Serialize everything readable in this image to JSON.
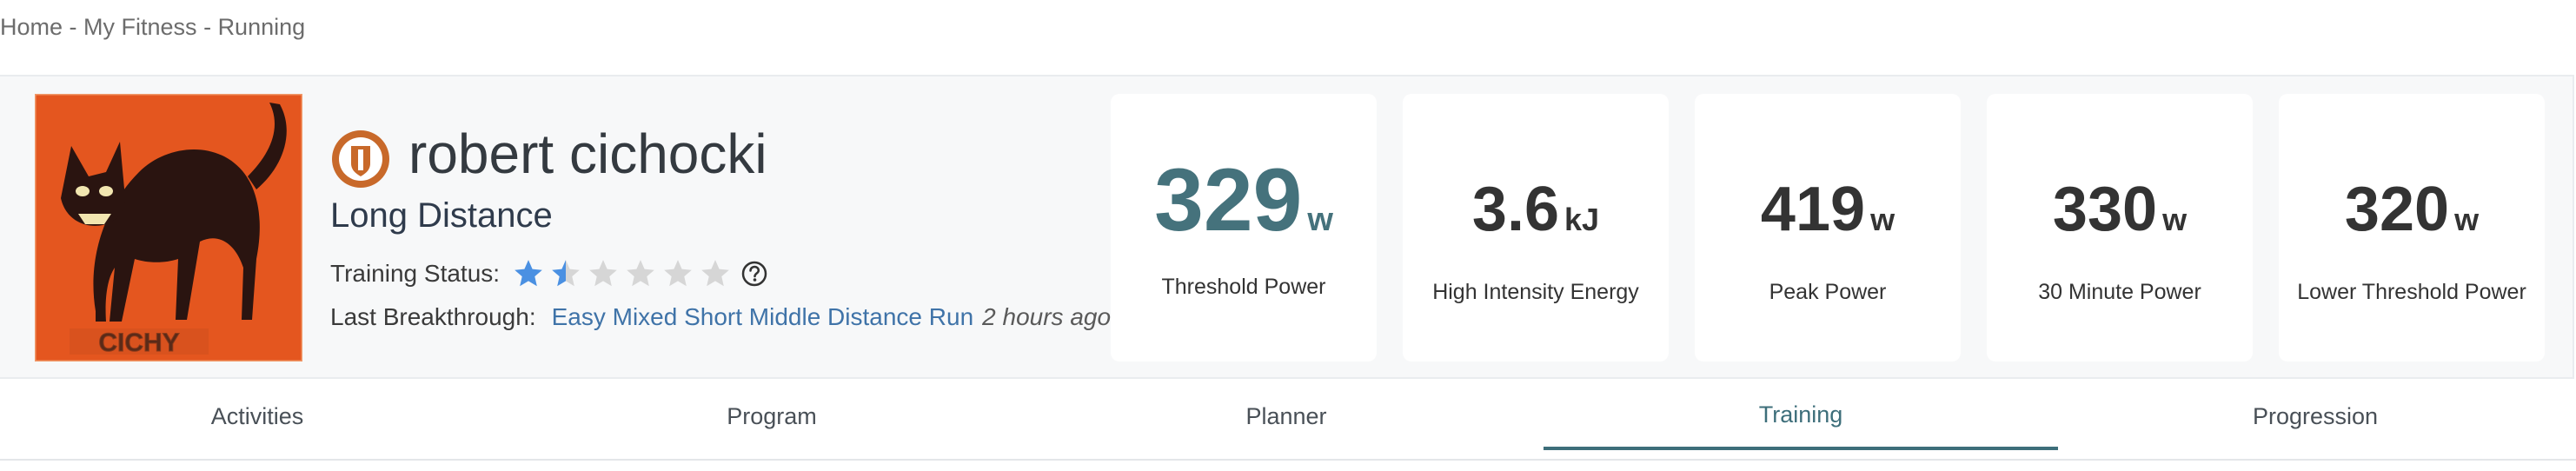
{
  "breadcrumb": {
    "items": [
      "Home",
      "My Fitness",
      "Running"
    ],
    "separator": " - "
  },
  "profile": {
    "name": "robert cichocki",
    "program": "Long Distance",
    "avatar_text": "CICHY",
    "training_status_label": "Training Status:",
    "training_status_rating": 1.5,
    "training_status_max": 6,
    "last_breakthrough_label": "Last Breakthrough:",
    "last_breakthrough_activity": "Easy Mixed Short Middle Distance Run",
    "last_breakthrough_time": "2 hours ago"
  },
  "metrics": [
    {
      "value": "329",
      "unit": "w",
      "label": "Threshold Power"
    },
    {
      "value": "3.6",
      "unit": "kJ",
      "label": "High Intensity Energy"
    },
    {
      "value": "419",
      "unit": "w",
      "label": "Peak Power"
    },
    {
      "value": "330",
      "unit": "w",
      "label": "30 Minute Power"
    },
    {
      "value": "320",
      "unit": "w",
      "label": "Lower Threshold Power"
    }
  ],
  "tabs": [
    {
      "label": "Activities",
      "active": false
    },
    {
      "label": "Program",
      "active": false
    },
    {
      "label": "Planner",
      "active": false
    },
    {
      "label": "Training",
      "active": true
    },
    {
      "label": "Progression",
      "active": false
    }
  ],
  "colors": {
    "accent": "#45727c",
    "link": "#3f73a8",
    "star_filled": "#4a90e2",
    "star_empty": "#d6d6d6",
    "badge": "#c8692a"
  }
}
